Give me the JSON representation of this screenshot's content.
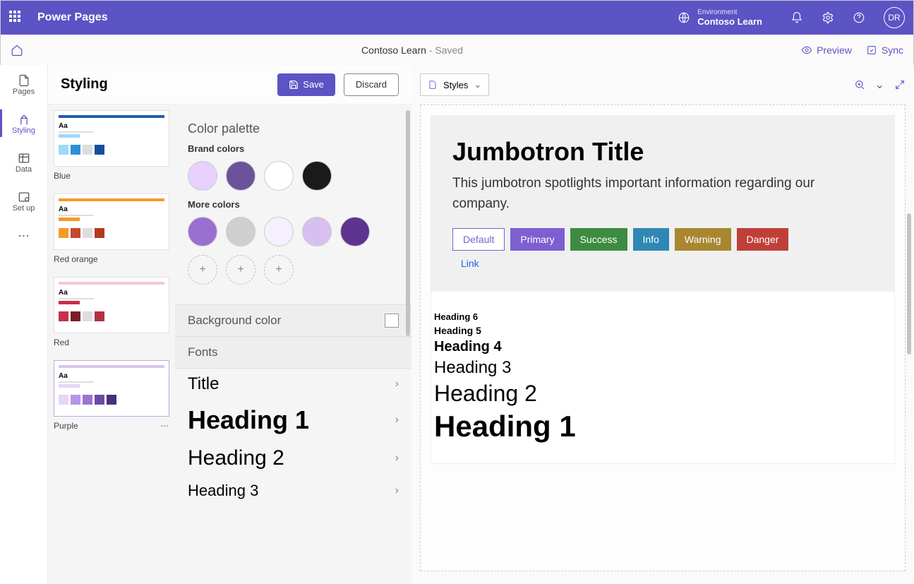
{
  "header": {
    "app_title": "Power Pages",
    "env_label": "Environment",
    "env_name": "Contoso Learn",
    "avatar_initials": "DR"
  },
  "subbar": {
    "site_name": "Contoso Learn",
    "status": " - Saved",
    "preview": "Preview",
    "sync": "Sync"
  },
  "rail": {
    "items": [
      {
        "label": "Pages"
      },
      {
        "label": "Styling"
      },
      {
        "label": "Data"
      },
      {
        "label": "Set up"
      }
    ]
  },
  "styling": {
    "title": "Styling",
    "save": "Save",
    "discard": "Discard"
  },
  "templates": [
    {
      "name": "Blue",
      "header": "#1e5db3",
      "swatches": [
        "#9fd8f7",
        "#2e8fd6",
        "#dddddd",
        "#164f9c"
      ]
    },
    {
      "name": "Red orange",
      "header": "#f59a23",
      "swatches": [
        "#f59a23",
        "#c44a2b",
        "#dddddd",
        "#b23a1e"
      ]
    },
    {
      "name": "Red",
      "header": "#f2c9cf",
      "swatches": [
        "#c6304a",
        "#7a1e2b",
        "#dddddd",
        "#b23141"
      ]
    },
    {
      "name": "Purple",
      "header": "#d7c6f2",
      "swatches": [
        "#e5d6f7",
        "#b696e3",
        "#9b73d1",
        "#6b4aa6",
        "#4a2e7a"
      ]
    }
  ],
  "palette": {
    "title": "Color palette",
    "brand_label": "Brand colors",
    "brand": [
      "#e8d0ff",
      "#6a539b",
      "#ffffff",
      "#1a1a1a"
    ],
    "more_label": "More colors",
    "more": [
      "#9a6fd1",
      "#cfcfcf",
      "#f5efff",
      "#d7c0f0",
      "#5e338f"
    ]
  },
  "bg": {
    "label": "Background color"
  },
  "fonts": {
    "title": "Fonts",
    "items": [
      "Title",
      "Heading 1",
      "Heading 2",
      "Heading 3"
    ]
  },
  "preview_toolbar": {
    "styles": "Styles"
  },
  "jumbo": {
    "title": "Jumbotron Title",
    "text": "This jumbotron spotlights important information regarding our company.",
    "buttons": {
      "default": "Default",
      "primary": "Primary",
      "success": "Success",
      "info": "Info",
      "warning": "Warning",
      "danger": "Danger"
    },
    "link": "Link"
  },
  "headings": {
    "h6": "Heading 6",
    "h5": "Heading 5",
    "h4": "Heading 4",
    "h3": "Heading 3",
    "h2": "Heading 2",
    "h1": "Heading 1"
  }
}
